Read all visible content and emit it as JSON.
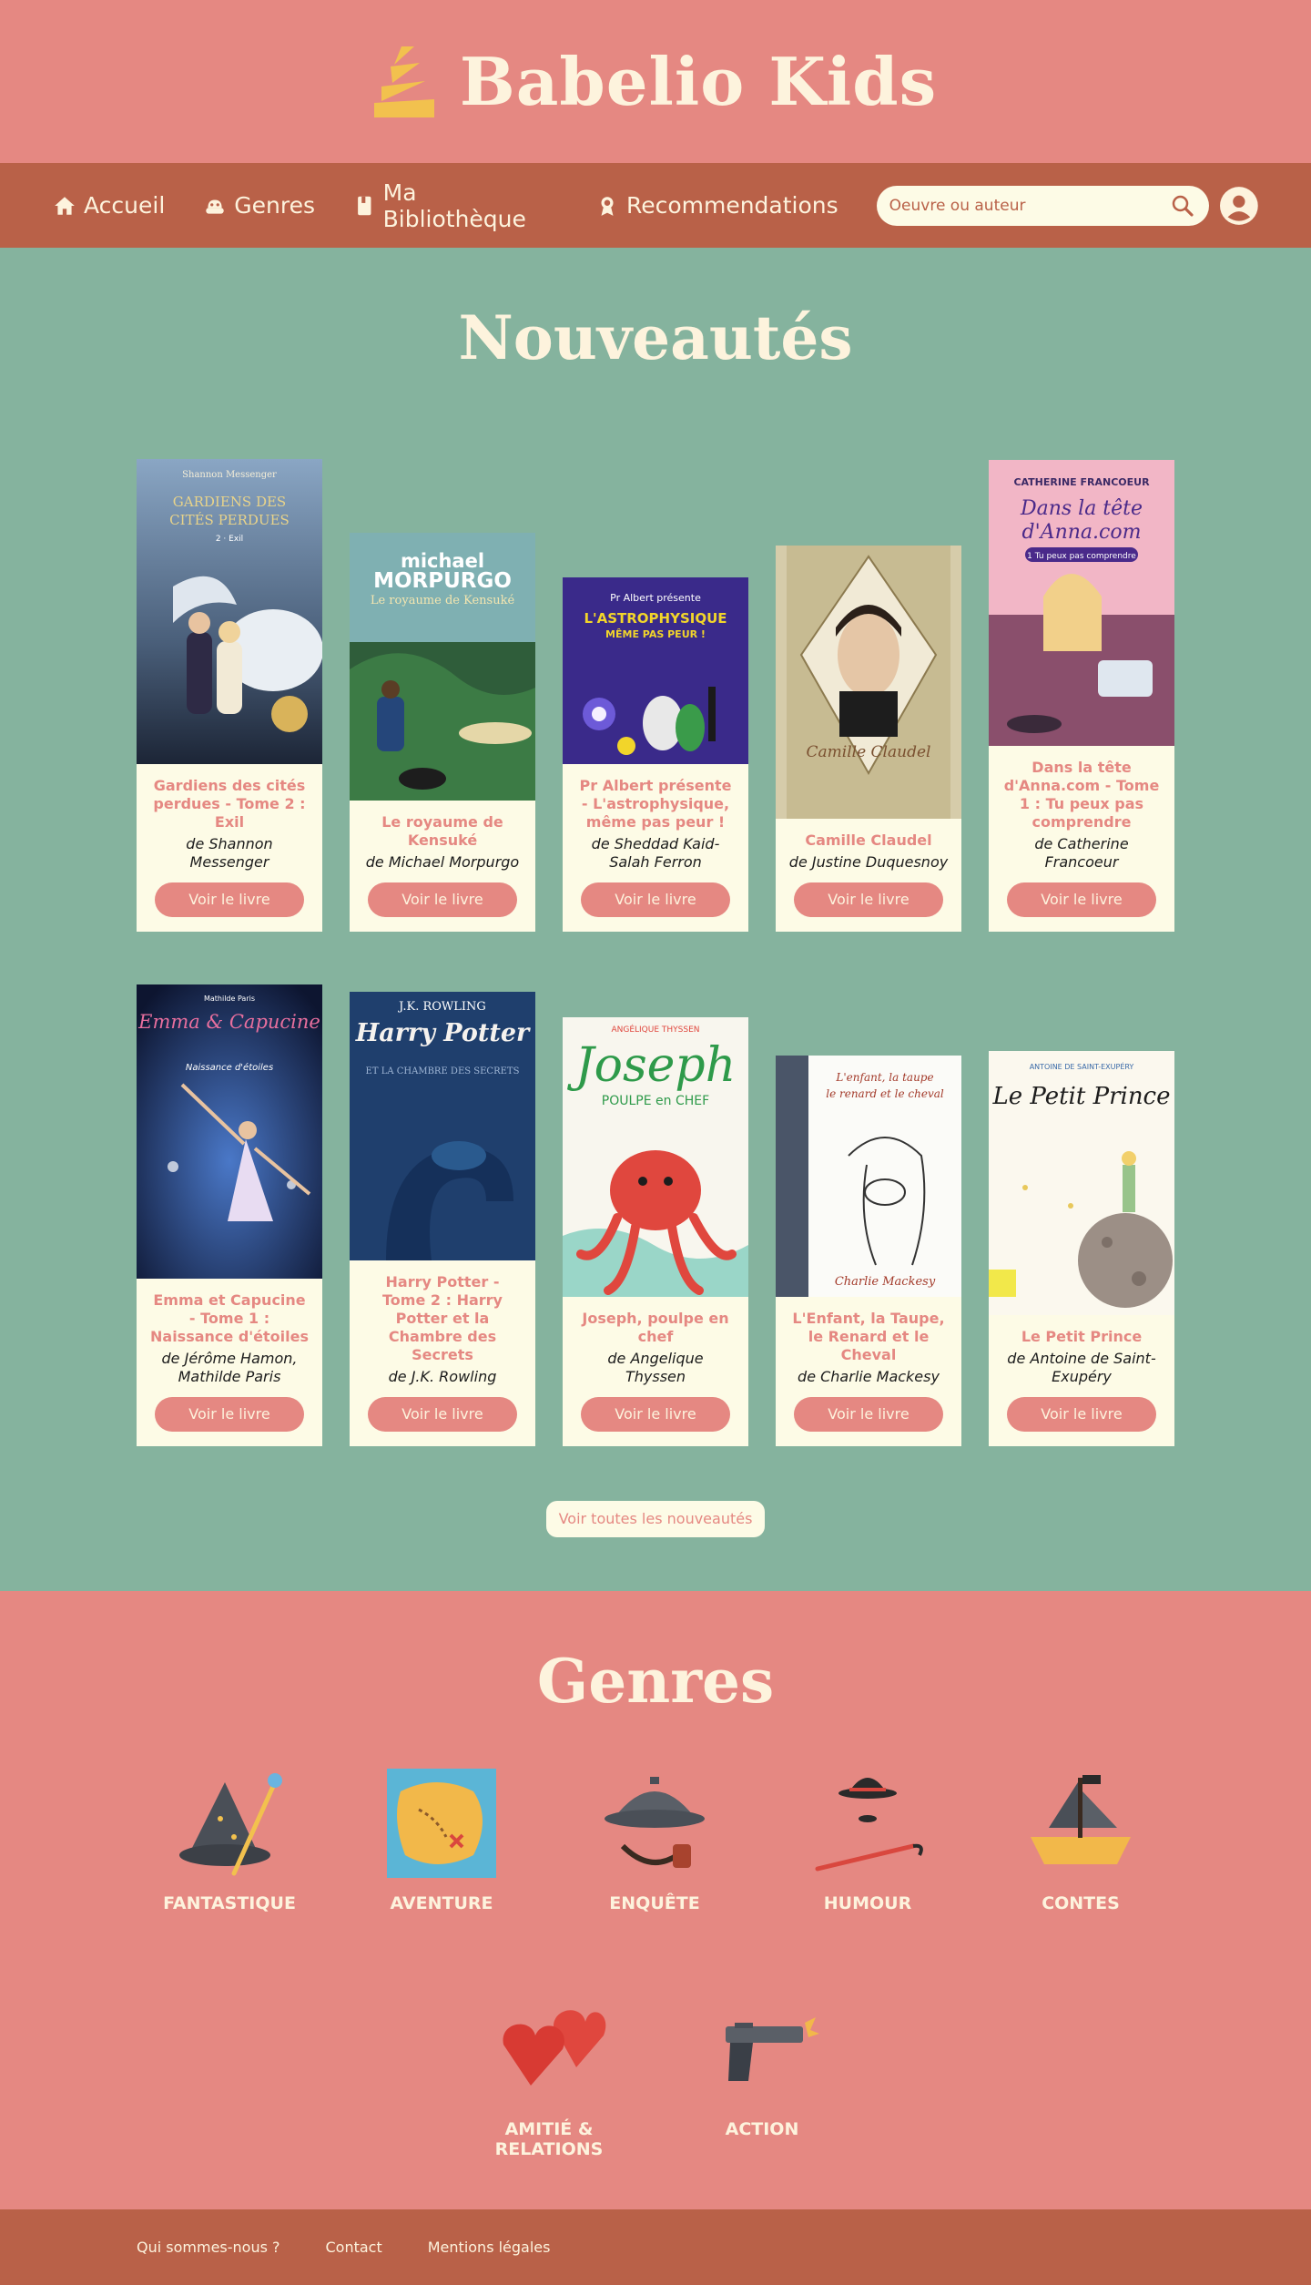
{
  "brand": {
    "name": "Babelio Kids"
  },
  "nav": {
    "items": [
      {
        "label": "Accueil",
        "icon": "home-icon"
      },
      {
        "label": "Genres",
        "icon": "genres-icon"
      },
      {
        "label": "Ma Bibliothèque",
        "icon": "book-icon"
      },
      {
        "label": "Recommendations",
        "icon": "ribbon-icon"
      }
    ],
    "search_placeholder": "Oeuvre ou auteur"
  },
  "colors": {
    "header": "#e58882",
    "nav": "#b96148",
    "news_bg": "#85b39e",
    "cream": "#fdfbe6"
  },
  "news": {
    "title": "Nouveautés",
    "button_label": "Voir le livre",
    "all_label": "Voir toutes les nouveautés",
    "books": [
      {
        "title": "Gardiens des cités perdues - Tome 2 : Exil",
        "author": "de Shannon Messenger",
        "cover_author": "Shannon Messenger",
        "cover_title": "GARDIENS DES CITÉS PERDUES",
        "cover_sub": "2 · Exil"
      },
      {
        "title": "Le royaume de Kensuké",
        "author": "de Michael Morpurgo",
        "cover_author": "michael MORPURGO",
        "cover_title": "Le royaume de Kensuké"
      },
      {
        "title": "Pr Albert présente - L'astrophysique, même pas peur !",
        "author": "de Sheddad Kaid-Salah Ferron",
        "cover_author": "Pr Albert présente",
        "cover_title": "L'ASTROPHYSIQUE MÊME PAS PEUR !"
      },
      {
        "title": "Camille Claudel",
        "author": "de Justine Duquesnoy",
        "cover_title": "Camille Claudel"
      },
      {
        "title": "Dans la tête d'Anna.com - Tome 1 : Tu peux pas comprendre",
        "author": "de Catherine Francoeur",
        "cover_author": "CATHERINE FRANCOEUR",
        "cover_title": "Dans la tête d'Anna.com",
        "cover_sub": "1 Tu peux pas comprendre"
      },
      {
        "title": "Emma et Capucine - Tome 1 : Naissance d'étoiles",
        "author": "de Jérôme Hamon, Mathilde Paris",
        "cover_author": "Mathilde Paris",
        "cover_title": "Emma & Capucine",
        "cover_sub": "Naissance d'étoiles"
      },
      {
        "title": "Harry Potter - Tome 2 : Harry Potter et la Chambre des Secrets",
        "author": "de J.K. Rowling",
        "cover_author": "J.K. ROWLING",
        "cover_title": "Harry Potter",
        "cover_sub": "ET LA CHAMBRE DES SECRETS"
      },
      {
        "title": "Joseph, poulpe en chef",
        "author": "de Angelique Thyssen",
        "cover_author": "ANGÉLIQUE THYSSEN",
        "cover_title": "Joseph",
        "cover_sub": "POULPE en CHEF"
      },
      {
        "title": "L'Enfant, la Taupe, le Renard et le Cheval",
        "author": "de Charlie Mackesy",
        "cover_title": "L'enfant, la taupe, le renard et le cheval",
        "cover_author": "Charlie Mackesy"
      },
      {
        "title": "Le Petit Prince",
        "author": "de Antoine de Saint-Exupéry",
        "cover_author": "ANTOINE DE SAINT-EXUPÉRY",
        "cover_title": "Le Petit Prince"
      }
    ]
  },
  "genres": {
    "title": "Genres",
    "items": [
      {
        "label": "FANTASTIQUE",
        "icon": "wizard-hat-icon"
      },
      {
        "label": "AVENTURE",
        "icon": "treasure-map-icon"
      },
      {
        "label": "ENQUÊTE",
        "icon": "detective-hat-pipe-icon"
      },
      {
        "label": "HUMOUR",
        "icon": "bowler-hat-cane-icon"
      },
      {
        "label": "CONTES",
        "icon": "pirate-ship-icon"
      },
      {
        "label": "AMITIÉ & RELATIONS",
        "icon": "hearts-icon"
      },
      {
        "label": "ACTION",
        "icon": "pistol-icon"
      }
    ]
  },
  "footer": {
    "links": [
      "Qui sommes-nous ?",
      "Contact",
      "Mentions légales"
    ]
  }
}
